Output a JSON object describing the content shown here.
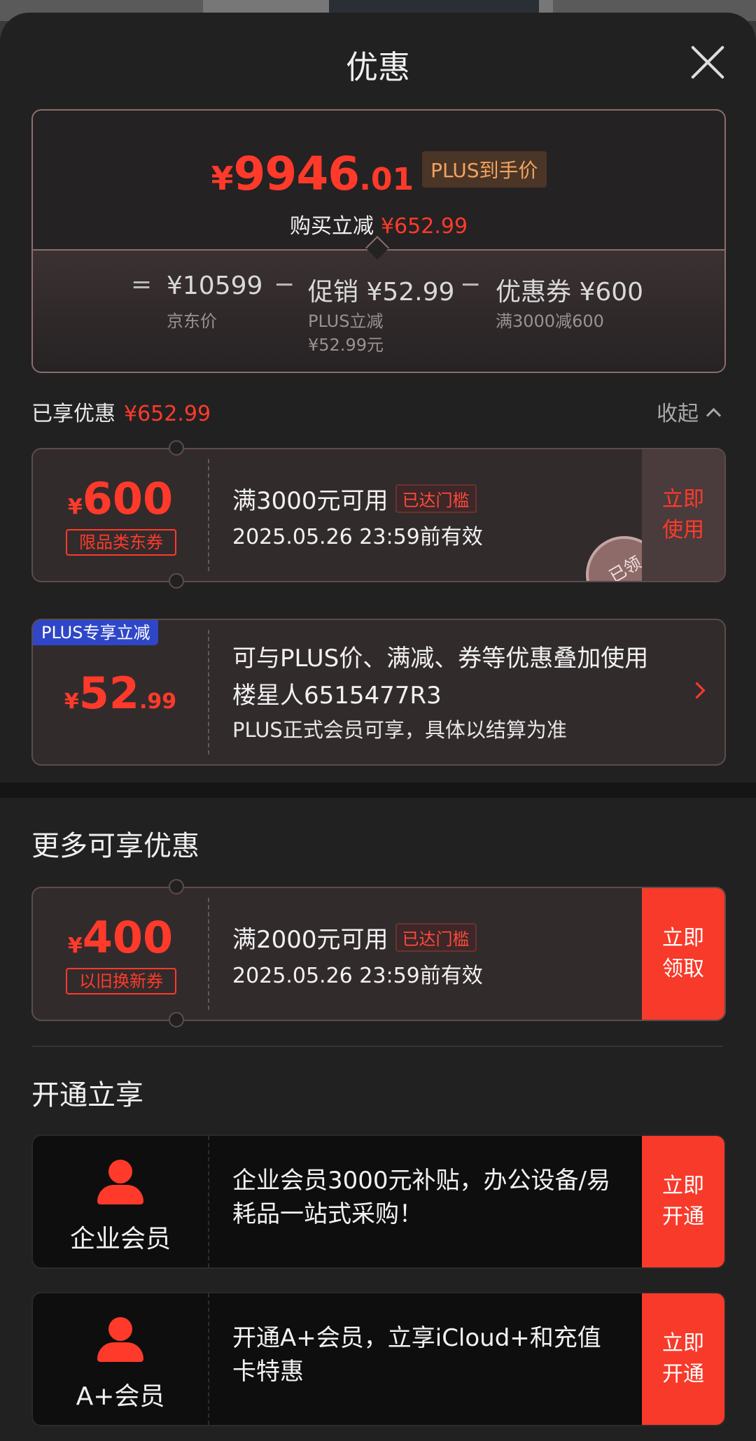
{
  "header": {
    "title": "优惠"
  },
  "summary": {
    "currency": "¥",
    "price_int": "9946",
    "price_dec": ".01",
    "price_tag": "PLUS到手价",
    "reduce_label": "购买立减",
    "reduce_value": "¥652.99",
    "eq": "=",
    "minus": "−",
    "jd_price": "¥10599",
    "jd_price_label": "京东价",
    "promo": "促销 ¥52.99",
    "promo_sub1": "PLUS立减",
    "promo_sub2": "¥52.99元",
    "coupon": "优惠券 ¥600",
    "coupon_sub": "满3000减600"
  },
  "enjoyed": {
    "label": "已享优惠",
    "value": "¥652.99",
    "collapse": "收起"
  },
  "coupon1": {
    "currency": "¥",
    "amount": "600",
    "type": "限品类东券",
    "condition": "满3000元可用",
    "badge": "已达门槛",
    "validity": "2025.05.26 23:59前有效",
    "action_line1": "立即",
    "action_line2": "使用",
    "stamp": "已领"
  },
  "plus_offer": {
    "tag": "PLUS专享立减",
    "currency": "¥",
    "amount": "52",
    "decimal": ".99",
    "line1": "可与PLUS价、满减、券等优惠叠加使用",
    "line2": "楼星人6515477R3",
    "line3": "PLUS正式会员可享，具体以结算为准"
  },
  "more_section": {
    "title": "更多可享优惠"
  },
  "coupon2": {
    "currency": "¥",
    "amount": "400",
    "type": "以旧换新券",
    "condition": "满2000元可用",
    "badge": "已达门槛",
    "validity": "2025.05.26 23:59前有效",
    "action_line1": "立即",
    "action_line2": "领取"
  },
  "open_section": {
    "title": "开通立享"
  },
  "membership1": {
    "name": "企业会员",
    "text": " 企业会员3000元补贴，办公设备/易耗品一站式采购！",
    "action_line1": "立即",
    "action_line2": "开通",
    "icon": "person-icon"
  },
  "membership2": {
    "name": "A+会员",
    "text": "开通A+会员，立享iCloud+和充值卡特惠",
    "action_line1": "立即",
    "action_line2": "开通",
    "icon": "person-icon"
  },
  "colors": {
    "accent": "#ff3a2b",
    "sheet": "#222122",
    "plus_blue": "#2f46c8"
  }
}
